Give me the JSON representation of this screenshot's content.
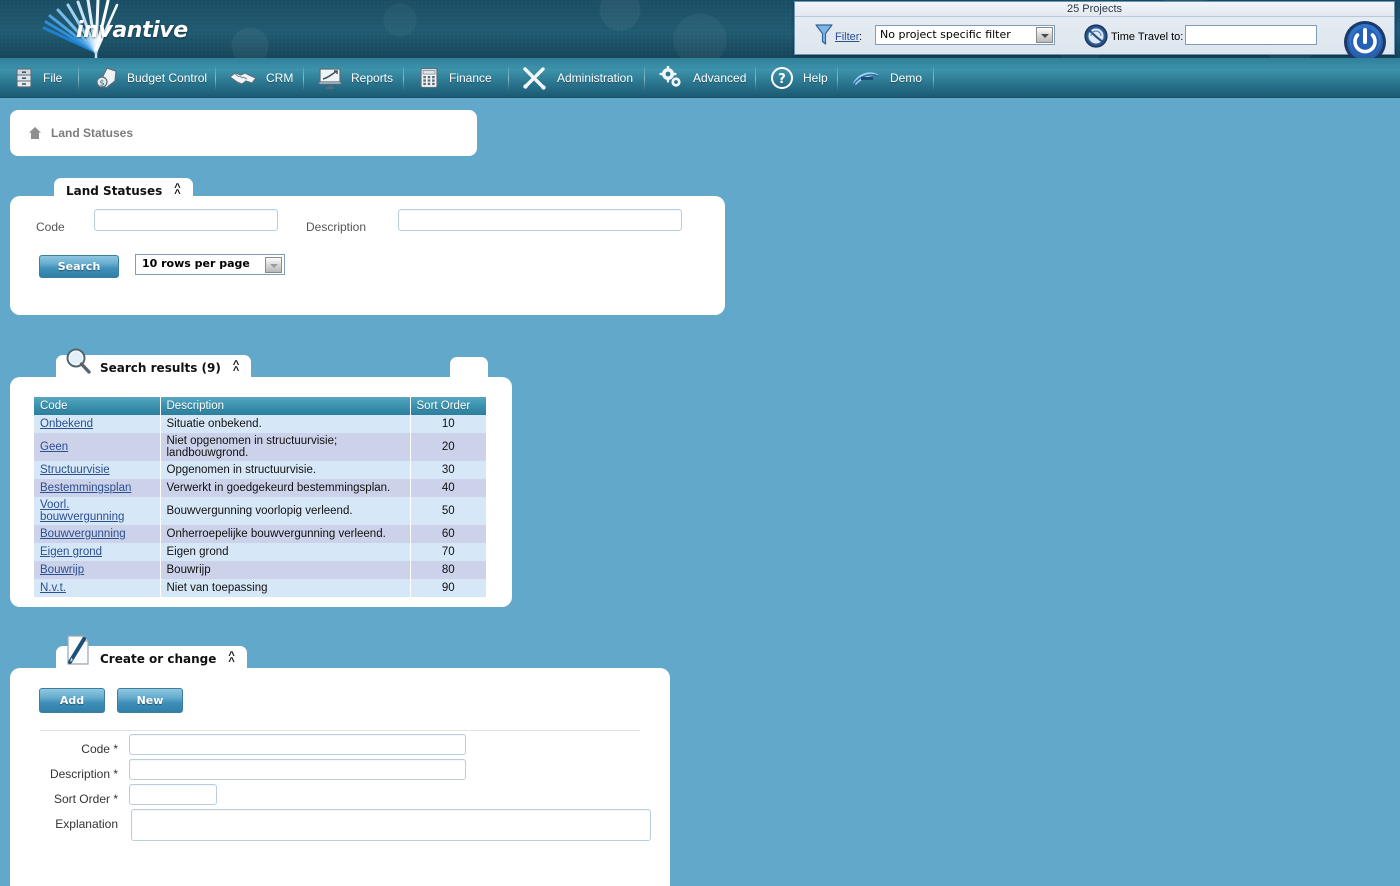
{
  "brand": {
    "wordmark": "invantive"
  },
  "toolpanel": {
    "caption": "25 Projects",
    "filter_label": "Filter",
    "filter_colon": ":",
    "filter_value": "No project specific filter",
    "filter_options": [
      "No project specific filter"
    ],
    "time_travel_label": "Time Travel to:",
    "time_travel_value": "",
    "time_travel_placeholder": ""
  },
  "menu": {
    "items": [
      {
        "label": "File",
        "icon": "cabinet-icon"
      },
      {
        "label": "Budget Control",
        "icon": "money-shield-icon"
      },
      {
        "label": "CRM",
        "icon": "handshake-icon"
      },
      {
        "label": "Reports",
        "icon": "presentation-chart-icon"
      },
      {
        "label": "Finance",
        "icon": "calculator-icon"
      },
      {
        "label": "Administration",
        "icon": "tools-icon"
      },
      {
        "label": "Advanced",
        "icon": "gears-icon"
      },
      {
        "label": "Help",
        "icon": "question-circle-icon"
      },
      {
        "label": "Demo",
        "icon": "invantive-swoosh-icon"
      }
    ]
  },
  "breadcrumb": {
    "icon": "home-icon",
    "text": "Land Statuses"
  },
  "search_panel": {
    "tab_title": "Land Statuses",
    "collapse_icon": "chevron-double-up-icon",
    "code_label": "Code",
    "code_value": "",
    "description_label": "Description",
    "description_value": "",
    "search_button": "Search",
    "rows_per_page": "10 rows per page",
    "rows_per_page_options": [
      "10 rows per page"
    ]
  },
  "results_panel": {
    "tab_title": "Search results (9)",
    "tab_icon": "magnifier-icon",
    "collapse_icon": "chevron-double-up-icon",
    "columns": [
      "Code",
      "Description",
      "Sort Order"
    ],
    "rows": [
      {
        "code": "Onbekend",
        "description": "Situatie onbekend.",
        "sort_order": "10"
      },
      {
        "code": "Geen",
        "description": "Niet opgenomen in structuurvisie; landbouwgrond.",
        "sort_order": "20"
      },
      {
        "code": "Structuurvisie",
        "description": "Opgenomen in structuurvisie.",
        "sort_order": "30"
      },
      {
        "code": "Bestemmingsplan",
        "description": "Verwerkt in goedgekeurd bestemmingsplan.",
        "sort_order": "40"
      },
      {
        "code": "Voorl. bouwvergunning",
        "description": "Bouwvergunning voorlopig verleend.",
        "sort_order": "50"
      },
      {
        "code": "Bouwvergunning",
        "description": "Onherroepelijke bouwvergunning verleend.",
        "sort_order": "60"
      },
      {
        "code": "Eigen grond",
        "description": "Eigen grond",
        "sort_order": "70"
      },
      {
        "code": "Bouwrijp",
        "description": "Bouwrijp",
        "sort_order": "80"
      },
      {
        "code": "N.v.t.",
        "description": "Niet van toepassing",
        "sort_order": "90"
      }
    ]
  },
  "create_panel": {
    "tab_title": "Create or change",
    "tab_icon": "document-pencil-icon",
    "collapse_icon": "chevron-double-up-icon",
    "add_button": "Add",
    "new_button": "New",
    "fields": [
      {
        "label": "Code *",
        "value": ""
      },
      {
        "label": "Description *",
        "value": ""
      },
      {
        "label": "Sort Order *",
        "value": ""
      },
      {
        "label": "Explanation",
        "value": ""
      }
    ]
  },
  "colors": {
    "page_background": "#62a8cb",
    "banner": "#1d4e63",
    "menubar": "#2f7f99",
    "accent": "#2b7e9c",
    "link": "#2b4f8f",
    "row_odd": "#d6e8f7",
    "row_even": "#ccd2ea"
  }
}
